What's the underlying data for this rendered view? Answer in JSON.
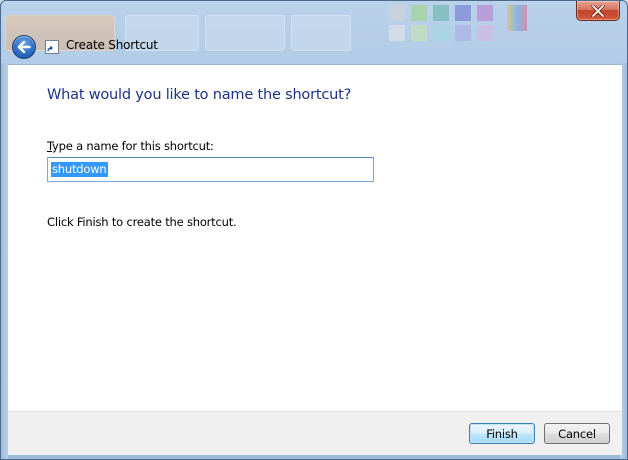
{
  "window": {
    "title": "Create Shortcut"
  },
  "icons": {
    "back": "back-arrow-icon",
    "app": "shortcut-icon",
    "close": "close-icon"
  },
  "content": {
    "heading": "What would you like to name the shortcut?",
    "name_label_accel": "T",
    "name_label_rest": "ype a name for this shortcut:",
    "name_value": "shutdown",
    "finish_note": "Click Finish to create the shortcut."
  },
  "buttons": {
    "finish": "Finish",
    "cancel": "Cancel"
  },
  "colors": {
    "heading": "#1e3287",
    "selection": "#3399ff",
    "close_button": "#c0462a"
  }
}
